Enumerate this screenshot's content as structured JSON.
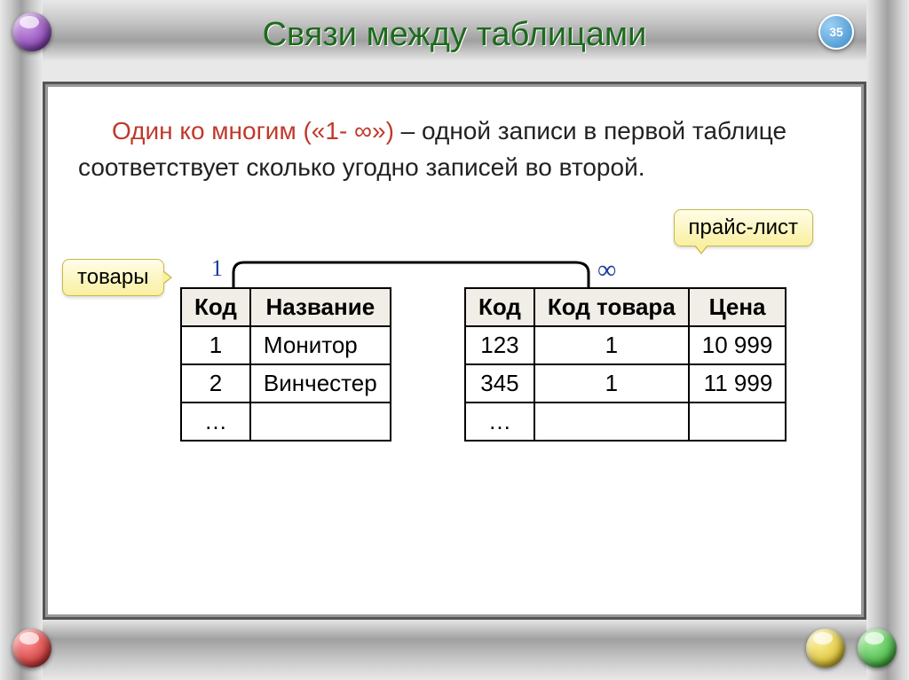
{
  "title": "Связи между таблицами",
  "page_number": "35",
  "paragraph": {
    "lead": "Один ко многим («1- ∞»)",
    "rest": " – одной записи в первой таблице соответствует сколько угодно записей во второй."
  },
  "tags": {
    "left": "товары",
    "right": "прайс-лист"
  },
  "connection": {
    "left_label": "1",
    "right_label": "∞"
  },
  "left_table": {
    "headers": [
      "Код",
      "Название"
    ],
    "rows": [
      [
        "1",
        "Монитор"
      ],
      [
        "2",
        "Винчестер"
      ],
      [
        "…",
        ""
      ]
    ]
  },
  "right_table": {
    "headers": [
      "Код",
      "Код товара",
      "Цена"
    ],
    "rows": [
      [
        "123",
        "1",
        "10 999"
      ],
      [
        "345",
        "1",
        "11 999"
      ],
      [
        "…",
        "",
        ""
      ]
    ]
  }
}
